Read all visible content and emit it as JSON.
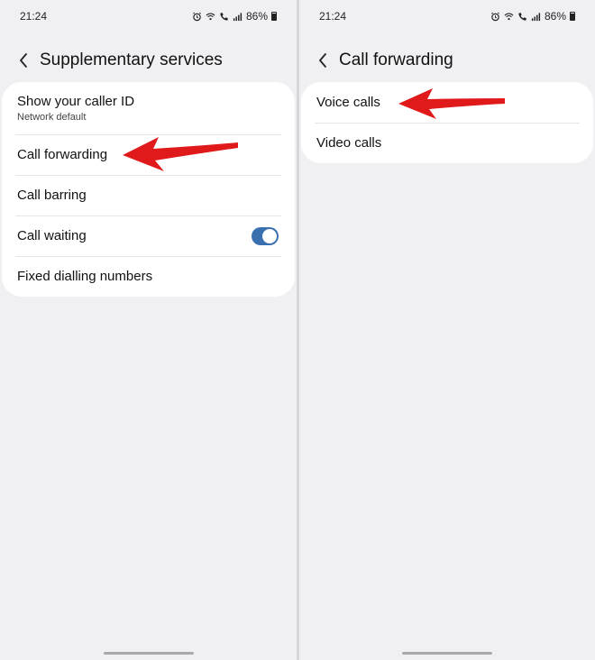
{
  "status_bar": {
    "time": "21:24",
    "battery": "86%"
  },
  "left": {
    "title": "Supplementary services",
    "items": [
      {
        "label": "Show your caller ID",
        "sub": "Network default"
      },
      {
        "label": "Call forwarding"
      },
      {
        "label": "Call barring"
      },
      {
        "label": "Call waiting",
        "toggle_on": true
      },
      {
        "label": "Fixed dialling numbers"
      }
    ]
  },
  "right": {
    "title": "Call forwarding",
    "items": [
      {
        "label": "Voice calls"
      },
      {
        "label": "Video calls"
      }
    ]
  },
  "colors": {
    "background": "#f0eff2",
    "card": "#ffffff",
    "toggle_on": "#3a6fb0",
    "annotation_arrow": "#e0191b"
  },
  "icons": [
    "alarm-icon",
    "wifi-calling-icon",
    "volte-call-icon",
    "signal-icon",
    "battery-icon",
    "back-chevron-icon",
    "red-arrow-annotation"
  ]
}
